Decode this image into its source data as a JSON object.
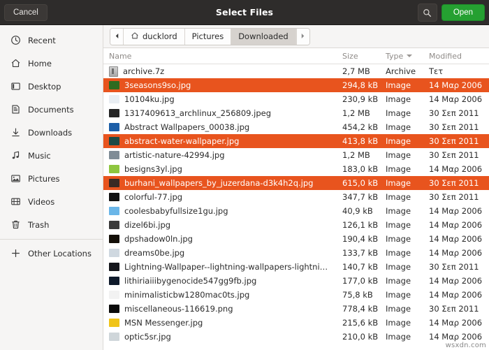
{
  "header": {
    "title": "Select Files",
    "cancel_label": "Cancel",
    "open_label": "Open",
    "search_icon": "search-icon"
  },
  "colors": {
    "titlebar": "#2e2c2b",
    "selection": "#e8541e",
    "open_button": "#25a031",
    "sidebar": "#f6f5f4"
  },
  "sidebar": {
    "items": [
      {
        "label": "Recent",
        "icon": "clock-icon"
      },
      {
        "label": "Home",
        "icon": "home-icon"
      },
      {
        "label": "Desktop",
        "icon": "desktop-icon"
      },
      {
        "label": "Documents",
        "icon": "document-icon"
      },
      {
        "label": "Downloads",
        "icon": "download-icon"
      },
      {
        "label": "Music",
        "icon": "music-note-icon"
      },
      {
        "label": "Pictures",
        "icon": "picture-icon"
      },
      {
        "label": "Videos",
        "icon": "video-icon"
      },
      {
        "label": "Trash",
        "icon": "trash-icon"
      }
    ],
    "other_locations": {
      "label": "Other Locations",
      "icon": "plus-icon"
    }
  },
  "pathbar": {
    "back_icon": "chevron-left-icon",
    "forward_icon": "chevron-right-icon",
    "crumbs": [
      {
        "label": "ducklord",
        "icon": "home-icon",
        "active": false
      },
      {
        "label": "Pictures",
        "icon": "",
        "active": false
      },
      {
        "label": "Downloaded",
        "icon": "",
        "active": true
      }
    ]
  },
  "columns": {
    "name": "Name",
    "size": "Size",
    "type": "Type",
    "modified": "Modified",
    "sorted_by": "Type",
    "sort_icon": "sort-descending-icon"
  },
  "files": [
    {
      "name": "archive.7z",
      "size": "2,7 MB",
      "type": "Archive",
      "modified": "Τετ",
      "selected": false,
      "icon": "archive-file-icon",
      "thumb": "#b9b9b9"
    },
    {
      "name": "3seasons9so.jpg",
      "size": "294,8 kB",
      "type": "Image",
      "modified": "14 Μαρ 2006",
      "selected": true,
      "icon": "image-thumbnail",
      "thumb": "#2f6b20"
    },
    {
      "name": "10104ku.jpg",
      "size": "230,9 kB",
      "type": "Image",
      "modified": "14 Μαρ 2006",
      "selected": false,
      "icon": "image-thumbnail",
      "thumb": "#e9eef3"
    },
    {
      "name": "1317409613_archlinux_256809.jpeg",
      "size": "1,2 MB",
      "type": "Image",
      "modified": "30 Σεπ 2011",
      "selected": false,
      "icon": "image-thumbnail",
      "thumb": "#252525"
    },
    {
      "name": "Abstract Wallpapers_00038.jpg",
      "size": "454,2 kB",
      "type": "Image",
      "modified": "30 Σεπ 2011",
      "selected": false,
      "icon": "image-thumbnail",
      "thumb": "#1d5fa8"
    },
    {
      "name": "abstract-water-wallpaper.jpg",
      "size": "413,8 kB",
      "type": "Image",
      "modified": "30 Σεπ 2011",
      "selected": true,
      "icon": "image-thumbnail",
      "thumb": "#1d4a44"
    },
    {
      "name": "artistic-nature-42994.jpg",
      "size": "1,2 MB",
      "type": "Image",
      "modified": "30 Σεπ 2011",
      "selected": false,
      "icon": "image-thumbnail",
      "thumb": "#7f8c96"
    },
    {
      "name": "besigns3yl.jpg",
      "size": "183,0 kB",
      "type": "Image",
      "modified": "14 Μαρ 2006",
      "selected": false,
      "icon": "image-thumbnail",
      "thumb": "#8ec63f"
    },
    {
      "name": "burhani_wallpapers_by_juzerdana-d3k4h2q.jpg",
      "size": "615,0 kB",
      "type": "Image",
      "modified": "30 Σεπ 2011",
      "selected": true,
      "icon": "image-thumbnail",
      "thumb": "#3a2a24"
    },
    {
      "name": "colorful-77.jpg",
      "size": "347,7 kB",
      "type": "Image",
      "modified": "30 Σεπ 2011",
      "selected": false,
      "icon": "image-thumbnail",
      "thumb": "#111111"
    },
    {
      "name": "coolesbabyfullsize1gu.jpg",
      "size": "40,9 kB",
      "type": "Image",
      "modified": "14 Μαρ 2006",
      "selected": false,
      "icon": "image-thumbnail",
      "thumb": "#6ab6e8"
    },
    {
      "name": "dizel6bi.jpg",
      "size": "126,1 kB",
      "type": "Image",
      "modified": "14 Μαρ 2006",
      "selected": false,
      "icon": "image-thumbnail",
      "thumb": "#3a3a3a"
    },
    {
      "name": "dpshadow0ln.jpg",
      "size": "190,4 kB",
      "type": "Image",
      "modified": "14 Μαρ 2006",
      "selected": false,
      "icon": "image-thumbnail",
      "thumb": "#140f08"
    },
    {
      "name": "dreams0be.jpg",
      "size": "133,7 kB",
      "type": "Image",
      "modified": "14 Μαρ 2006",
      "selected": false,
      "icon": "image-thumbnail",
      "thumb": "#cfd8e0"
    },
    {
      "name": "Lightning-Wallpaper--lightning-wallpapers-lightni…",
      "size": "140,7 kB",
      "type": "Image",
      "modified": "30 Σεπ 2011",
      "selected": false,
      "icon": "image-thumbnail",
      "thumb": "#15171c"
    },
    {
      "name": "lithiriaiiibygenocide547gg9fb.jpg",
      "size": "177,0 kB",
      "type": "Image",
      "modified": "14 Μαρ 2006",
      "selected": false,
      "icon": "image-thumbnail",
      "thumb": "#0f1a2b"
    },
    {
      "name": "minimalisticbw1280mac0ts.jpg",
      "size": "75,8 kB",
      "type": "Image",
      "modified": "14 Μαρ 2006",
      "selected": false,
      "icon": "image-thumbnail",
      "thumb": "#f2f2f2"
    },
    {
      "name": "miscellaneous-116619.png",
      "size": "778,4 kB",
      "type": "Image",
      "modified": "30 Σεπ 2011",
      "selected": false,
      "icon": "image-thumbnail",
      "thumb": "#0b0b0b"
    },
    {
      "name": "MSN Messenger.jpg",
      "size": "215,6 kB",
      "type": "Image",
      "modified": "14 Μαρ 2006",
      "selected": false,
      "icon": "image-thumbnail",
      "thumb": "#f0c419"
    },
    {
      "name": "optic5sr.jpg",
      "size": "210,0 kB",
      "type": "Image",
      "modified": "14 Μαρ 2006",
      "selected": false,
      "icon": "image-thumbnail",
      "thumb": "#cfd6da"
    }
  ],
  "watermark": "wsxdn.com"
}
